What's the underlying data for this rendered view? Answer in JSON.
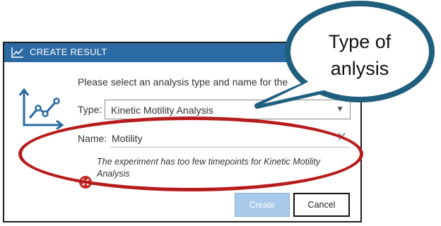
{
  "dialog": {
    "title": "CREATE RESULT",
    "prompt": "Please select an analysis type and name for the",
    "type_label": "Type:",
    "type_value": "Kinetic Motility Analysis",
    "name_label": "Name:",
    "name_value": "Motility",
    "error_message": "The experiment has too few timepoints for Kinetic Motility Analysis",
    "create_label": "Create",
    "cancel_label": "Cancel"
  },
  "annotation": {
    "callout_line1": "Type of",
    "callout_line2": "anlysis"
  },
  "icons": {
    "title": "line-chart-icon",
    "main": "line-chart-axes-icon",
    "dropdown": "chevron-down-icon",
    "clear": "close-icon",
    "error": "error-circle-icon"
  },
  "colors": {
    "titlebar": "#2b6aa3",
    "create_button": "#a9c9ea",
    "error": "#c62828",
    "annotation_ellipse": "#b71c1c",
    "callout_fill": "#ffffff",
    "callout_stroke": "#1f5f7e"
  }
}
